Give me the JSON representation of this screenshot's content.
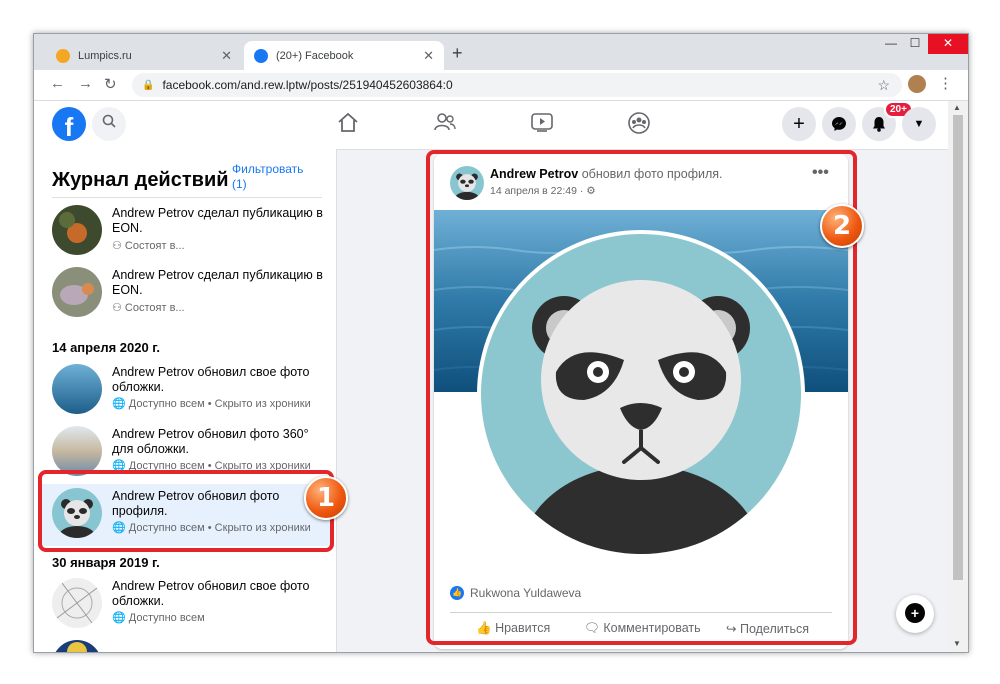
{
  "browser": {
    "tabs": [
      {
        "title": "Lumpics.ru",
        "favicon_color": "#f5a623",
        "close": "✕"
      },
      {
        "title": "(20+) Facebook",
        "favicon_color": "#1877f2",
        "close": "✕"
      }
    ],
    "new_tab": "+",
    "window_controls": {
      "minimize": "—",
      "maximize": "☐",
      "close": "✕"
    },
    "nav": {
      "back": "←",
      "forward": "→",
      "reload": "↻"
    },
    "url": "facebook.com/and.rew.lptw/posts/2519404526038­64/0",
    "url_display": "facebook.com/and.rew.lptw/posts/251940452603864:0",
    "lock": "🔒",
    "star": "☆",
    "menu": "⋮"
  },
  "facebook": {
    "logo": "f",
    "search_icon": "⌕",
    "nav_icons": [
      "home-icon",
      "friends-icon",
      "watch-icon",
      "groups-icon"
    ],
    "nav_glyphs": {
      "home": "⌂",
      "friends": "👥",
      "watch": "▶",
      "groups": "☺"
    },
    "actions": {
      "create": "+",
      "messenger": "✉",
      "notifications": "🔔",
      "account": "▼"
    },
    "notification_badge": "20+"
  },
  "activity_log": {
    "title": "Журнал действий",
    "filter_label": "Фильтровать",
    "filter_count": "(1)",
    "entries_top": [
      {
        "text": "Andrew Petrov сделал публикацию в EON.",
        "meta": "Состоят в..."
      },
      {
        "text": "Andrew Petrov сделал публикацию в EON.",
        "meta": "Состоят в..."
      }
    ],
    "date1": "14 апреля 2020 г.",
    "entries_april": [
      {
        "text": "Andrew Petrov обновил свое фото обложки.",
        "meta": "Доступно всем • Скрыто из хроники"
      },
      {
        "text": "Andrew Petrov обновил фото 360° для обложки.",
        "meta": "Доступно всем • Скрыто из хроники"
      },
      {
        "text": "Andrew Petrov обновил фото профиля.",
        "meta": "Доступно всем • Скрыто из хроники"
      }
    ],
    "date2": "30 января 2019 г.",
    "entries_january": [
      {
        "text": "Andrew Petrov обновил свое фото обложки.",
        "meta": "Доступно всем"
      }
    ]
  },
  "post": {
    "author": "Andrew Petrov",
    "action": "обновил фото профиля.",
    "date": "14 апреля в 22:49 · ⚙",
    "more": "•••",
    "reaction_user": "Rukwona Yuldaweva",
    "like_label": "Нравится",
    "comment_label": "Комментировать",
    "share_label": "Поделиться"
  },
  "annotations": {
    "marker1": "1",
    "marker2": "2",
    "color": "#e3262b"
  },
  "compose_fab": "+"
}
